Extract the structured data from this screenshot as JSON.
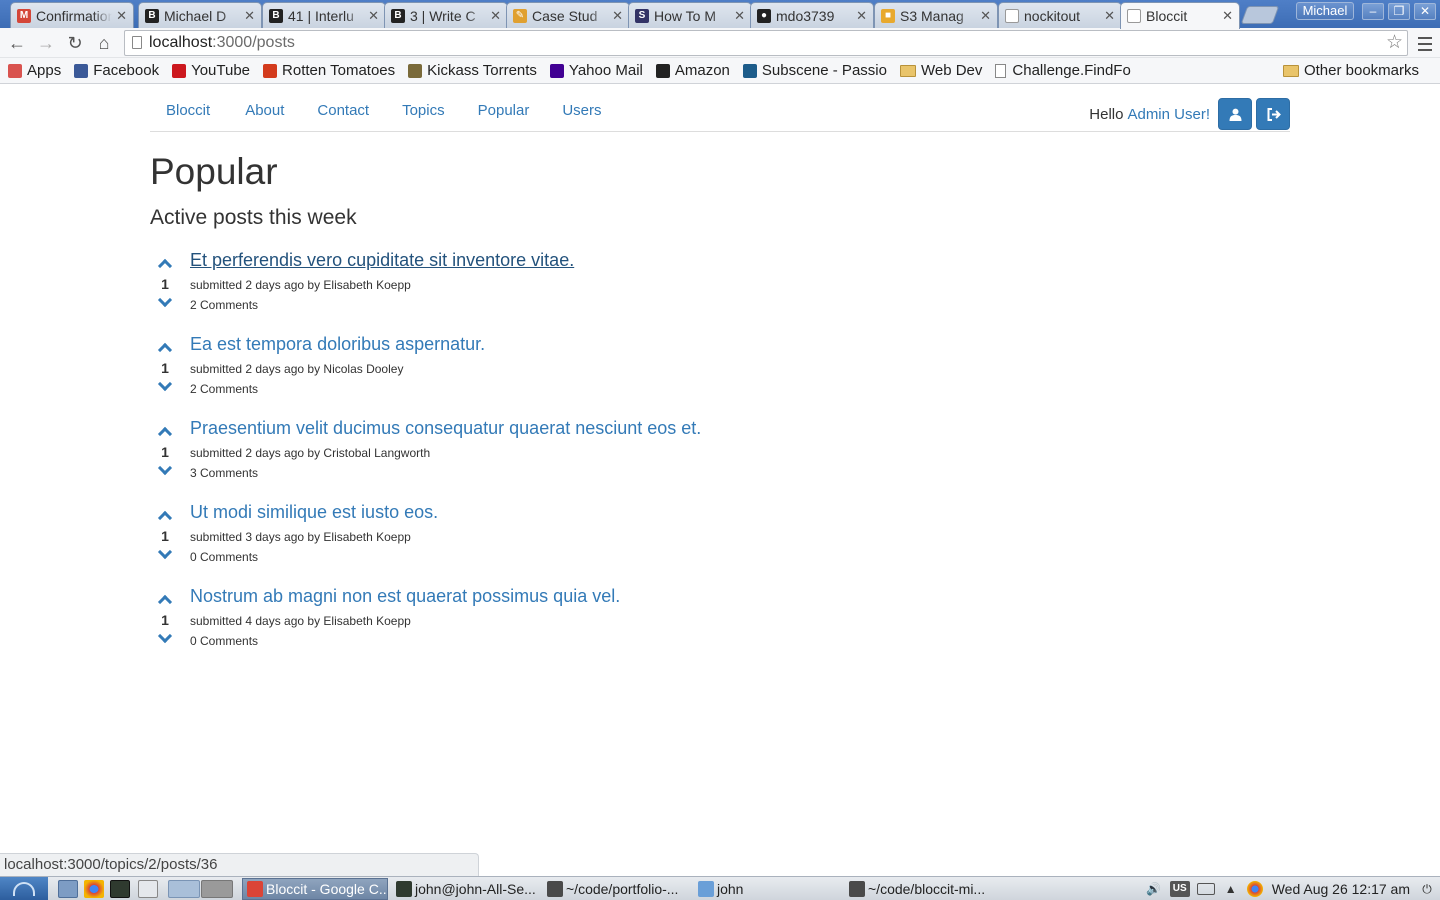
{
  "browser": {
    "tabs": [
      {
        "label": "Confirmation",
        "favicon": "gmail-icon",
        "color": "#d44638",
        "glyph": "M"
      },
      {
        "label": "Michael D",
        "favicon": "bloc-icon",
        "color": "#222222",
        "glyph": "B"
      },
      {
        "label": "41 | Interlu",
        "favicon": "bloc-icon",
        "color": "#222222",
        "glyph": "B"
      },
      {
        "label": "3 | Write C",
        "favicon": "bloc-icon",
        "color": "#222222",
        "glyph": "B"
      },
      {
        "label": "Case Stud",
        "favicon": "pencil-icon",
        "color": "#e0a030",
        "glyph": "✎"
      },
      {
        "label": "How To M",
        "favicon": "s-icon",
        "color": "#333366",
        "glyph": "S"
      },
      {
        "label": "mdo3739",
        "favicon": "github-icon",
        "color": "#222222",
        "glyph": "●"
      },
      {
        "label": "S3 Manag",
        "favicon": "aws-icon",
        "color": "#e8a92e",
        "glyph": "■"
      },
      {
        "label": "nockitout",
        "favicon": "page-icon",
        "color": "#ffffff",
        "glyph": ""
      },
      {
        "label": "Bloccit",
        "favicon": "page-icon",
        "color": "#ffffff",
        "glyph": "",
        "active": true
      }
    ],
    "profile_name": "Michael",
    "url_host": "localhost",
    "url_path": ":3000/posts",
    "bookmarks": [
      {
        "label": "Apps",
        "icon": "apps-grid-icon",
        "color": "#d9534f"
      },
      {
        "label": "Facebook",
        "icon": "facebook-icon",
        "color": "#3b5998"
      },
      {
        "label": "YouTube",
        "icon": "youtube-icon",
        "color": "#cc181e"
      },
      {
        "label": "Rotten Tomatoes",
        "icon": "tomato-icon",
        "color": "#d33b1d"
      },
      {
        "label": "Kickass Torrents",
        "icon": "kickass-icon",
        "color": "#7a6a3a"
      },
      {
        "label": "Yahoo Mail",
        "icon": "yahoo-icon",
        "color": "#410093"
      },
      {
        "label": "Amazon",
        "icon": "amazon-icon",
        "color": "#222222"
      },
      {
        "label": "Subscene - Passio",
        "icon": "subscene-icon",
        "color": "#1d5c8a"
      },
      {
        "label": "Web Dev",
        "icon": "folder-icon",
        "color": "#e9c46a"
      },
      {
        "label": "Challenge.FindFo",
        "icon": "page-icon",
        "color": "#ffffff"
      }
    ],
    "other_bookmarks": "Other bookmarks"
  },
  "site": {
    "nav": [
      "Bloccit",
      "About",
      "Contact",
      "Topics",
      "Popular",
      "Users"
    ],
    "hello": "Hello",
    "user_name": "Admin User!",
    "accent": "#337ab7"
  },
  "page": {
    "title": "Popular",
    "subtitle": "Active posts this week"
  },
  "posts": [
    {
      "title": "Et perferendis vero cupiditate sit inventore vitae.",
      "votes": "1",
      "meta": "submitted 2 days ago by Elisabeth Koepp",
      "comments": "2 Comments",
      "hovered": true
    },
    {
      "title": "Ea est tempora doloribus aspernatur.",
      "votes": "1",
      "meta": "submitted 2 days ago by Nicolas Dooley",
      "comments": "2 Comments"
    },
    {
      "title": "Praesentium velit ducimus consequatur quaerat nesciunt eos et.",
      "votes": "1",
      "meta": "submitted 2 days ago by Cristobal Langworth",
      "comments": "3 Comments"
    },
    {
      "title": "Ut modi similique est iusto eos.",
      "votes": "1",
      "meta": "submitted 3 days ago by Elisabeth Koepp",
      "comments": "0 Comments"
    },
    {
      "title": "Nostrum ab magni non est quaerat possimus quia vel.",
      "votes": "1",
      "meta": "submitted 4 days ago by Elisabeth Koepp",
      "comments": "0 Comments"
    }
  ],
  "status_url": "localhost:3000/topics/2/posts/36",
  "taskbar": {
    "tasks": [
      {
        "label": "Bloccit - Google C...",
        "icon": "chrome-icon",
        "color": "#db4437",
        "active": true
      },
      {
        "label": "john@john-All-Se...",
        "icon": "terminal-icon",
        "color": "#2f3a2f"
      },
      {
        "label": "~/code/portfolio-...",
        "icon": "sublime-icon",
        "color": "#4a4a4a"
      },
      {
        "label": "john",
        "icon": "folder-icon",
        "color": "#6a9fd8"
      },
      {
        "label": "~/code/bloccit-mi...",
        "icon": "sublime-icon",
        "color": "#4a4a4a"
      }
    ],
    "keyboard_layout": "US",
    "clock": "Wed Aug 26  12:17 am"
  }
}
